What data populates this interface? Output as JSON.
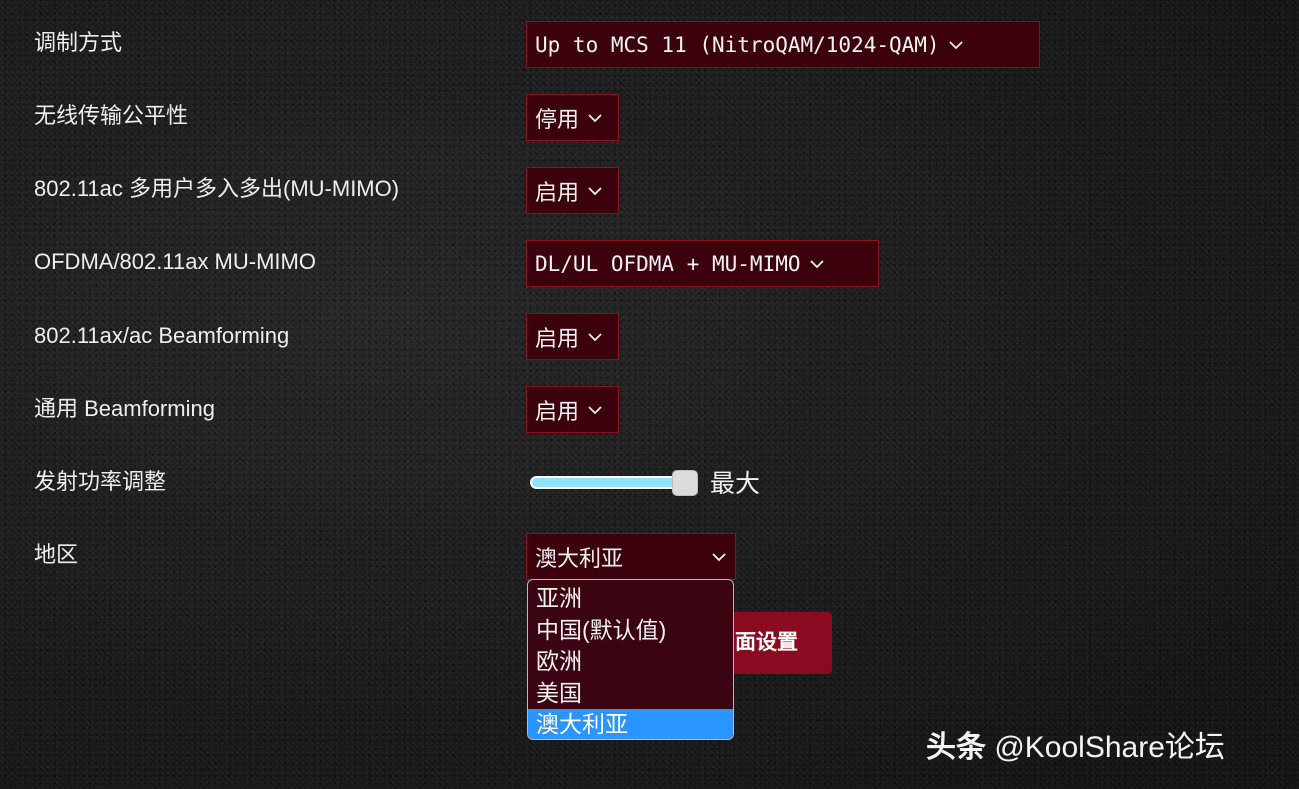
{
  "rows": [
    {
      "label": "调制方式",
      "value": "Up to MCS 11 (NitroQAM/1024-QAM)"
    },
    {
      "label": "无线传输公平性",
      "value": "停用"
    },
    {
      "label": "802.11ac 多用户多入多出(MU-MIMO)",
      "value": "启用"
    },
    {
      "label": "OFDMA/802.11ax MU-MIMO",
      "value": "DL/UL OFDMA + MU-MIMO"
    },
    {
      "label": "802.11ax/ac Beamforming",
      "value": "启用"
    },
    {
      "label": "通用 Beamforming",
      "value": "启用"
    }
  ],
  "tx_power": {
    "label": "发射功率调整",
    "value_label": "最大",
    "level_fraction": 1.0
  },
  "region": {
    "label": "地区",
    "value": "澳大利亚",
    "options": [
      "亚洲",
      "中国(默认值)",
      "欧洲",
      "美国",
      "澳大利亚"
    ],
    "selected_index": 4
  },
  "apply_button_label": "面设置",
  "watermark": {
    "prefix": "头条",
    "handle": "@KoolShare论坛"
  },
  "colors": {
    "select_bg": "#3b020e",
    "select_border": "#8c1024",
    "button_bg": "#8a0a1f",
    "slider_track": "#8ee2ff",
    "option_selected": "#2b95ff"
  },
  "icons": {
    "select_arrow": "chevron-down-icon"
  }
}
